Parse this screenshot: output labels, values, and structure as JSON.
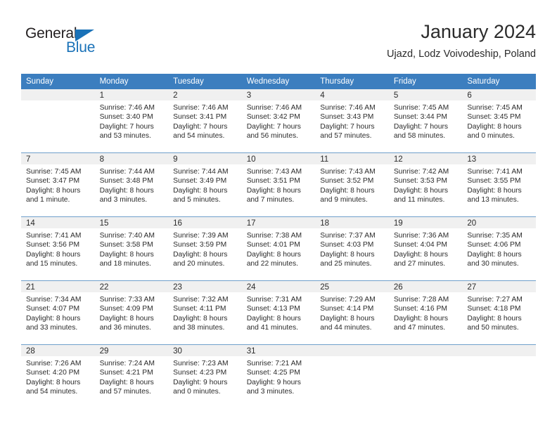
{
  "brand": {
    "name_part1": "General",
    "name_part2": "Blue",
    "triangle_color": "#1a72b8",
    "text_color": "#231f20",
    "accent_color": "#1a72b8"
  },
  "header": {
    "title": "January 2024",
    "subtitle": "Ujazd, Lodz Voivodeship, Poland"
  },
  "theme": {
    "header_bg": "#3c7ebf",
    "header_text": "#ffffff",
    "daynum_bg": "#f0f0f0",
    "row_divider": "#6f9fcb",
    "body_text": "#2b2b2b"
  },
  "weekdays": [
    "Sunday",
    "Monday",
    "Tuesday",
    "Wednesday",
    "Thursday",
    "Friday",
    "Saturday"
  ],
  "weeks": [
    [
      {
        "day": "",
        "blank": true,
        "sunrise": "",
        "sunset": "",
        "daylight1": "",
        "daylight2": ""
      },
      {
        "day": "1",
        "blank": false,
        "sunrise": "Sunrise: 7:46 AM",
        "sunset": "Sunset: 3:40 PM",
        "daylight1": "Daylight: 7 hours",
        "daylight2": "and 53 minutes."
      },
      {
        "day": "2",
        "blank": false,
        "sunrise": "Sunrise: 7:46 AM",
        "sunset": "Sunset: 3:41 PM",
        "daylight1": "Daylight: 7 hours",
        "daylight2": "and 54 minutes."
      },
      {
        "day": "3",
        "blank": false,
        "sunrise": "Sunrise: 7:46 AM",
        "sunset": "Sunset: 3:42 PM",
        "daylight1": "Daylight: 7 hours",
        "daylight2": "and 56 minutes."
      },
      {
        "day": "4",
        "blank": false,
        "sunrise": "Sunrise: 7:46 AM",
        "sunset": "Sunset: 3:43 PM",
        "daylight1": "Daylight: 7 hours",
        "daylight2": "and 57 minutes."
      },
      {
        "day": "5",
        "blank": false,
        "sunrise": "Sunrise: 7:45 AM",
        "sunset": "Sunset: 3:44 PM",
        "daylight1": "Daylight: 7 hours",
        "daylight2": "and 58 minutes."
      },
      {
        "day": "6",
        "blank": false,
        "sunrise": "Sunrise: 7:45 AM",
        "sunset": "Sunset: 3:45 PM",
        "daylight1": "Daylight: 8 hours",
        "daylight2": "and 0 minutes."
      }
    ],
    [
      {
        "day": "7",
        "blank": false,
        "sunrise": "Sunrise: 7:45 AM",
        "sunset": "Sunset: 3:47 PM",
        "daylight1": "Daylight: 8 hours",
        "daylight2": "and 1 minute."
      },
      {
        "day": "8",
        "blank": false,
        "sunrise": "Sunrise: 7:44 AM",
        "sunset": "Sunset: 3:48 PM",
        "daylight1": "Daylight: 8 hours",
        "daylight2": "and 3 minutes."
      },
      {
        "day": "9",
        "blank": false,
        "sunrise": "Sunrise: 7:44 AM",
        "sunset": "Sunset: 3:49 PM",
        "daylight1": "Daylight: 8 hours",
        "daylight2": "and 5 minutes."
      },
      {
        "day": "10",
        "blank": false,
        "sunrise": "Sunrise: 7:43 AM",
        "sunset": "Sunset: 3:51 PM",
        "daylight1": "Daylight: 8 hours",
        "daylight2": "and 7 minutes."
      },
      {
        "day": "11",
        "blank": false,
        "sunrise": "Sunrise: 7:43 AM",
        "sunset": "Sunset: 3:52 PM",
        "daylight1": "Daylight: 8 hours",
        "daylight2": "and 9 minutes."
      },
      {
        "day": "12",
        "blank": false,
        "sunrise": "Sunrise: 7:42 AM",
        "sunset": "Sunset: 3:53 PM",
        "daylight1": "Daylight: 8 hours",
        "daylight2": "and 11 minutes."
      },
      {
        "day": "13",
        "blank": false,
        "sunrise": "Sunrise: 7:41 AM",
        "sunset": "Sunset: 3:55 PM",
        "daylight1": "Daylight: 8 hours",
        "daylight2": "and 13 minutes."
      }
    ],
    [
      {
        "day": "14",
        "blank": false,
        "sunrise": "Sunrise: 7:41 AM",
        "sunset": "Sunset: 3:56 PM",
        "daylight1": "Daylight: 8 hours",
        "daylight2": "and 15 minutes."
      },
      {
        "day": "15",
        "blank": false,
        "sunrise": "Sunrise: 7:40 AM",
        "sunset": "Sunset: 3:58 PM",
        "daylight1": "Daylight: 8 hours",
        "daylight2": "and 18 minutes."
      },
      {
        "day": "16",
        "blank": false,
        "sunrise": "Sunrise: 7:39 AM",
        "sunset": "Sunset: 3:59 PM",
        "daylight1": "Daylight: 8 hours",
        "daylight2": "and 20 minutes."
      },
      {
        "day": "17",
        "blank": false,
        "sunrise": "Sunrise: 7:38 AM",
        "sunset": "Sunset: 4:01 PM",
        "daylight1": "Daylight: 8 hours",
        "daylight2": "and 22 minutes."
      },
      {
        "day": "18",
        "blank": false,
        "sunrise": "Sunrise: 7:37 AM",
        "sunset": "Sunset: 4:03 PM",
        "daylight1": "Daylight: 8 hours",
        "daylight2": "and 25 minutes."
      },
      {
        "day": "19",
        "blank": false,
        "sunrise": "Sunrise: 7:36 AM",
        "sunset": "Sunset: 4:04 PM",
        "daylight1": "Daylight: 8 hours",
        "daylight2": "and 27 minutes."
      },
      {
        "day": "20",
        "blank": false,
        "sunrise": "Sunrise: 7:35 AM",
        "sunset": "Sunset: 4:06 PM",
        "daylight1": "Daylight: 8 hours",
        "daylight2": "and 30 minutes."
      }
    ],
    [
      {
        "day": "21",
        "blank": false,
        "sunrise": "Sunrise: 7:34 AM",
        "sunset": "Sunset: 4:07 PM",
        "daylight1": "Daylight: 8 hours",
        "daylight2": "and 33 minutes."
      },
      {
        "day": "22",
        "blank": false,
        "sunrise": "Sunrise: 7:33 AM",
        "sunset": "Sunset: 4:09 PM",
        "daylight1": "Daylight: 8 hours",
        "daylight2": "and 36 minutes."
      },
      {
        "day": "23",
        "blank": false,
        "sunrise": "Sunrise: 7:32 AM",
        "sunset": "Sunset: 4:11 PM",
        "daylight1": "Daylight: 8 hours",
        "daylight2": "and 38 minutes."
      },
      {
        "day": "24",
        "blank": false,
        "sunrise": "Sunrise: 7:31 AM",
        "sunset": "Sunset: 4:13 PM",
        "daylight1": "Daylight: 8 hours",
        "daylight2": "and 41 minutes."
      },
      {
        "day": "25",
        "blank": false,
        "sunrise": "Sunrise: 7:29 AM",
        "sunset": "Sunset: 4:14 PM",
        "daylight1": "Daylight: 8 hours",
        "daylight2": "and 44 minutes."
      },
      {
        "day": "26",
        "blank": false,
        "sunrise": "Sunrise: 7:28 AM",
        "sunset": "Sunset: 4:16 PM",
        "daylight1": "Daylight: 8 hours",
        "daylight2": "and 47 minutes."
      },
      {
        "day": "27",
        "blank": false,
        "sunrise": "Sunrise: 7:27 AM",
        "sunset": "Sunset: 4:18 PM",
        "daylight1": "Daylight: 8 hours",
        "daylight2": "and 50 minutes."
      }
    ],
    [
      {
        "day": "28",
        "blank": false,
        "sunrise": "Sunrise: 7:26 AM",
        "sunset": "Sunset: 4:20 PM",
        "daylight1": "Daylight: 8 hours",
        "daylight2": "and 54 minutes."
      },
      {
        "day": "29",
        "blank": false,
        "sunrise": "Sunrise: 7:24 AM",
        "sunset": "Sunset: 4:21 PM",
        "daylight1": "Daylight: 8 hours",
        "daylight2": "and 57 minutes."
      },
      {
        "day": "30",
        "blank": false,
        "sunrise": "Sunrise: 7:23 AM",
        "sunset": "Sunset: 4:23 PM",
        "daylight1": "Daylight: 9 hours",
        "daylight2": "and 0 minutes."
      },
      {
        "day": "31",
        "blank": false,
        "sunrise": "Sunrise: 7:21 AM",
        "sunset": "Sunset: 4:25 PM",
        "daylight1": "Daylight: 9 hours",
        "daylight2": "and 3 minutes."
      },
      {
        "day": "",
        "blank": true,
        "sunrise": "",
        "sunset": "",
        "daylight1": "",
        "daylight2": ""
      },
      {
        "day": "",
        "blank": true,
        "sunrise": "",
        "sunset": "",
        "daylight1": "",
        "daylight2": ""
      },
      {
        "day": "",
        "blank": true,
        "sunrise": "",
        "sunset": "",
        "daylight1": "",
        "daylight2": ""
      }
    ]
  ]
}
